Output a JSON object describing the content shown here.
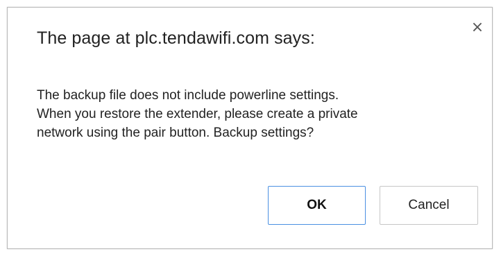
{
  "dialog": {
    "title": "The page at plc.tendawifi.com says:",
    "close_glyph": "×",
    "message_lines": [
      "The backup file does not include powerline settings.",
      "When you restore the extender, please create a private",
      "network using the pair button. Backup settings?"
    ],
    "ok_label": "OK",
    "cancel_label": "Cancel",
    "colors": {
      "ok_border": "#4a90e2",
      "cancel_border": "#c6c6c6",
      "dialog_border": "#b8b8b8",
      "text": "#222222"
    }
  }
}
